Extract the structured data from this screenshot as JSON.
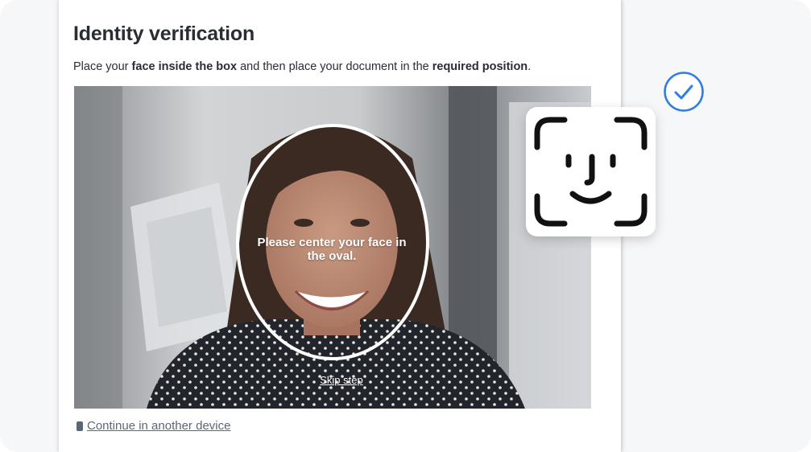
{
  "page": {
    "title": "Identity verification",
    "instructions": {
      "part1": "Place your ",
      "bold1": "face inside the box",
      "part2": " and then place your document in the ",
      "bold2": "required position",
      "part3": "."
    }
  },
  "camera": {
    "oval_message": "Please center your face in the oval.",
    "skip_label": "Skip step"
  },
  "footer": {
    "continue_label": "Continue in another device",
    "continue_icon": "phone-icon"
  },
  "badges": {
    "check_icon": "check-circle-icon",
    "faceid_icon": "face-id-icon"
  },
  "colors": {
    "accent": "#2f7de1",
    "link": "#5b6677",
    "title": "#2a2d33"
  }
}
